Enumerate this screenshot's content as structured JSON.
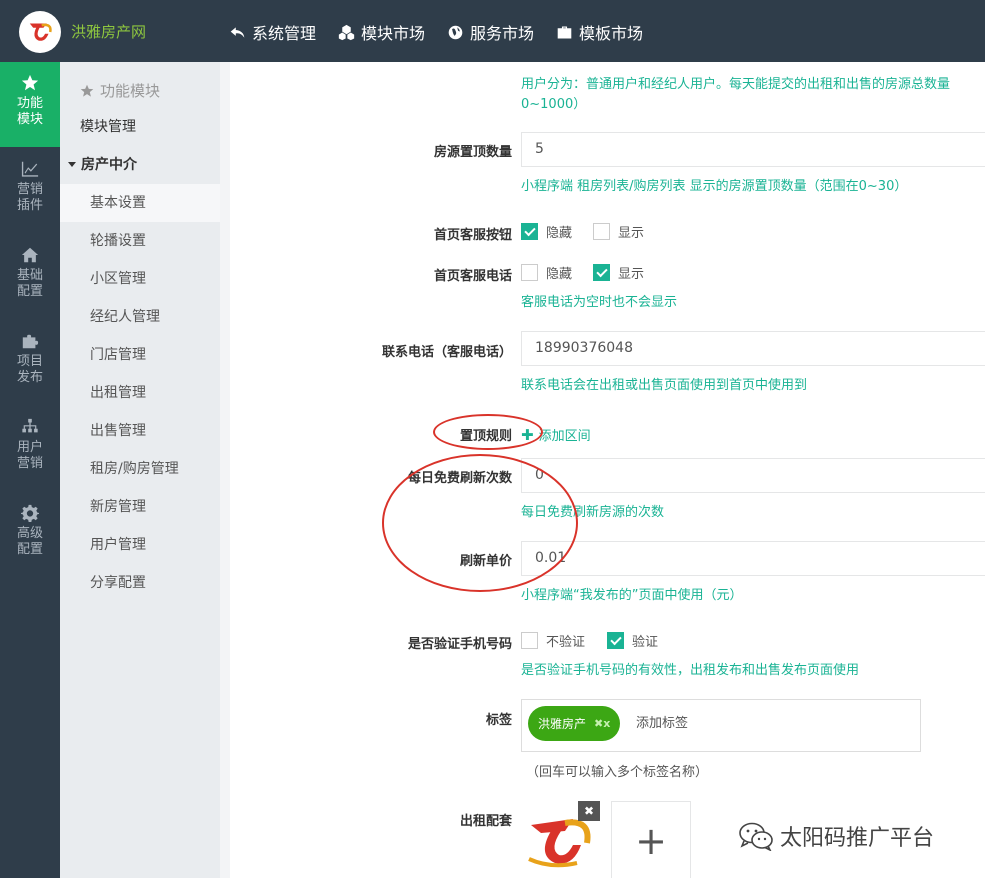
{
  "brand": {
    "name": "洪雅房产网"
  },
  "topnav": [
    {
      "label": "系统管理",
      "icon": "reply-icon"
    },
    {
      "label": "模块市场",
      "icon": "cubes-icon"
    },
    {
      "label": "服务市场",
      "icon": "globe-icon"
    },
    {
      "label": "模板市场",
      "icon": "briefcase-icon"
    }
  ],
  "rail": [
    {
      "label": "功能模块",
      "icon": "star-icon",
      "active": true
    },
    {
      "label": "营销插件",
      "icon": "chart-icon"
    },
    {
      "label": "基础配置",
      "icon": "home-icon"
    },
    {
      "label": "项目发布",
      "icon": "puzzle-icon"
    },
    {
      "label": "用户营销",
      "icon": "sitemap-icon"
    },
    {
      "label": "高级配置",
      "icon": "gear-icon"
    }
  ],
  "subnav": {
    "header": "功能模块",
    "module_manage": "模块管理",
    "group": "房产中介",
    "items": [
      "基本设置",
      "轮播设置",
      "小区管理",
      "经纪人管理",
      "门店管理",
      "出租管理",
      "出售管理",
      "租房/购房管理",
      "新房管理",
      "用户管理",
      "分享配置"
    ]
  },
  "form": {
    "top_help_line1": "用户分为：普通用户和经纪人用户。每天能提交的出租和出售的房源总数量",
    "top_help_line2": "0~1000）",
    "pin_count": {
      "label": "房源置顶数量",
      "value": "5",
      "help": "小程序端 租房列表/购房列表 显示的房源置顶数量（范围在0~30）"
    },
    "service_button": {
      "label": "首页客服按钮",
      "opt_hide": "隐藏",
      "opt_show": "显示",
      "selected": "hide"
    },
    "service_phone": {
      "label": "首页客服电话",
      "opt_hide": "隐藏",
      "opt_show": "显示",
      "selected": "show",
      "help": "客服电话为空时也不会显示"
    },
    "contact_phone": {
      "label": "联系电话（客服电话）",
      "value": "18990376048",
      "help": "联系电话会在出租或出售页面使用到首页中使用到"
    },
    "pin_rule": {
      "label": "置顶规则",
      "add": "添加区间"
    },
    "free_refresh": {
      "label": "每日免费刷新次数",
      "value": "0",
      "help": "每日免费刷新房源的次数"
    },
    "refresh_price": {
      "label": "刷新单价",
      "value": "0.01",
      "help": "小程序端“我发布的”页面中使用（元）"
    },
    "verify_phone": {
      "label": "是否验证手机号码",
      "opt_no": "不验证",
      "opt_yes": "验证",
      "selected": "yes",
      "help": "是否验证手机号码的有效性，出租发布和出售发布页面使用"
    },
    "tags": {
      "label": "标签",
      "tag": "洪雅房产",
      "tag_close": "✖x",
      "placeholder": "添加标签",
      "hint": "（回车可以输入多个标签名称）"
    },
    "rent_facilities": {
      "label": "出租配套",
      "close": "✖",
      "upload": "+"
    }
  },
  "watermark": {
    "text": "太阳码推广平台",
    "icon": "wechat-icon"
  },
  "colors": {
    "accent": "#1ab394",
    "nav_bg": "#2f3d4a",
    "active_rail": "#19b067",
    "annotation": "#d9332a"
  }
}
